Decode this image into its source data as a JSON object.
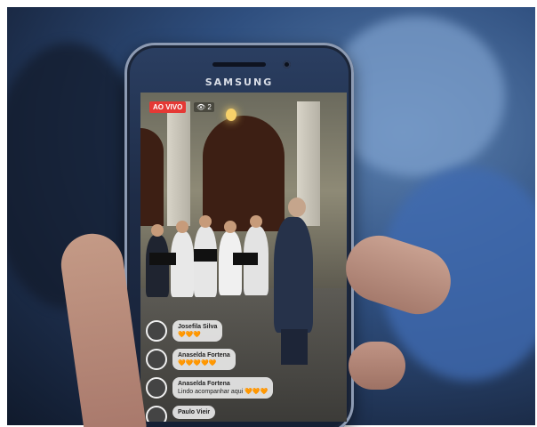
{
  "phone": {
    "brand": "SAMSUNG"
  },
  "stream": {
    "live_badge": "AO VIVO",
    "viewer_count": "2"
  },
  "comments": [
    {
      "name": "Josefila Silva",
      "text": "🧡🧡🧡"
    },
    {
      "name": "Anaselda Fortena",
      "text": "🧡🧡🧡🧡🧡"
    },
    {
      "name": "Anaselda Fortena",
      "text": "Lindo acompanhar aqui 🧡🧡🧡"
    },
    {
      "name": "Paulo Vieir",
      "text": ""
    }
  ],
  "colors": {
    "live_red": "#e53935",
    "background_blue": "#2f4f7f"
  }
}
